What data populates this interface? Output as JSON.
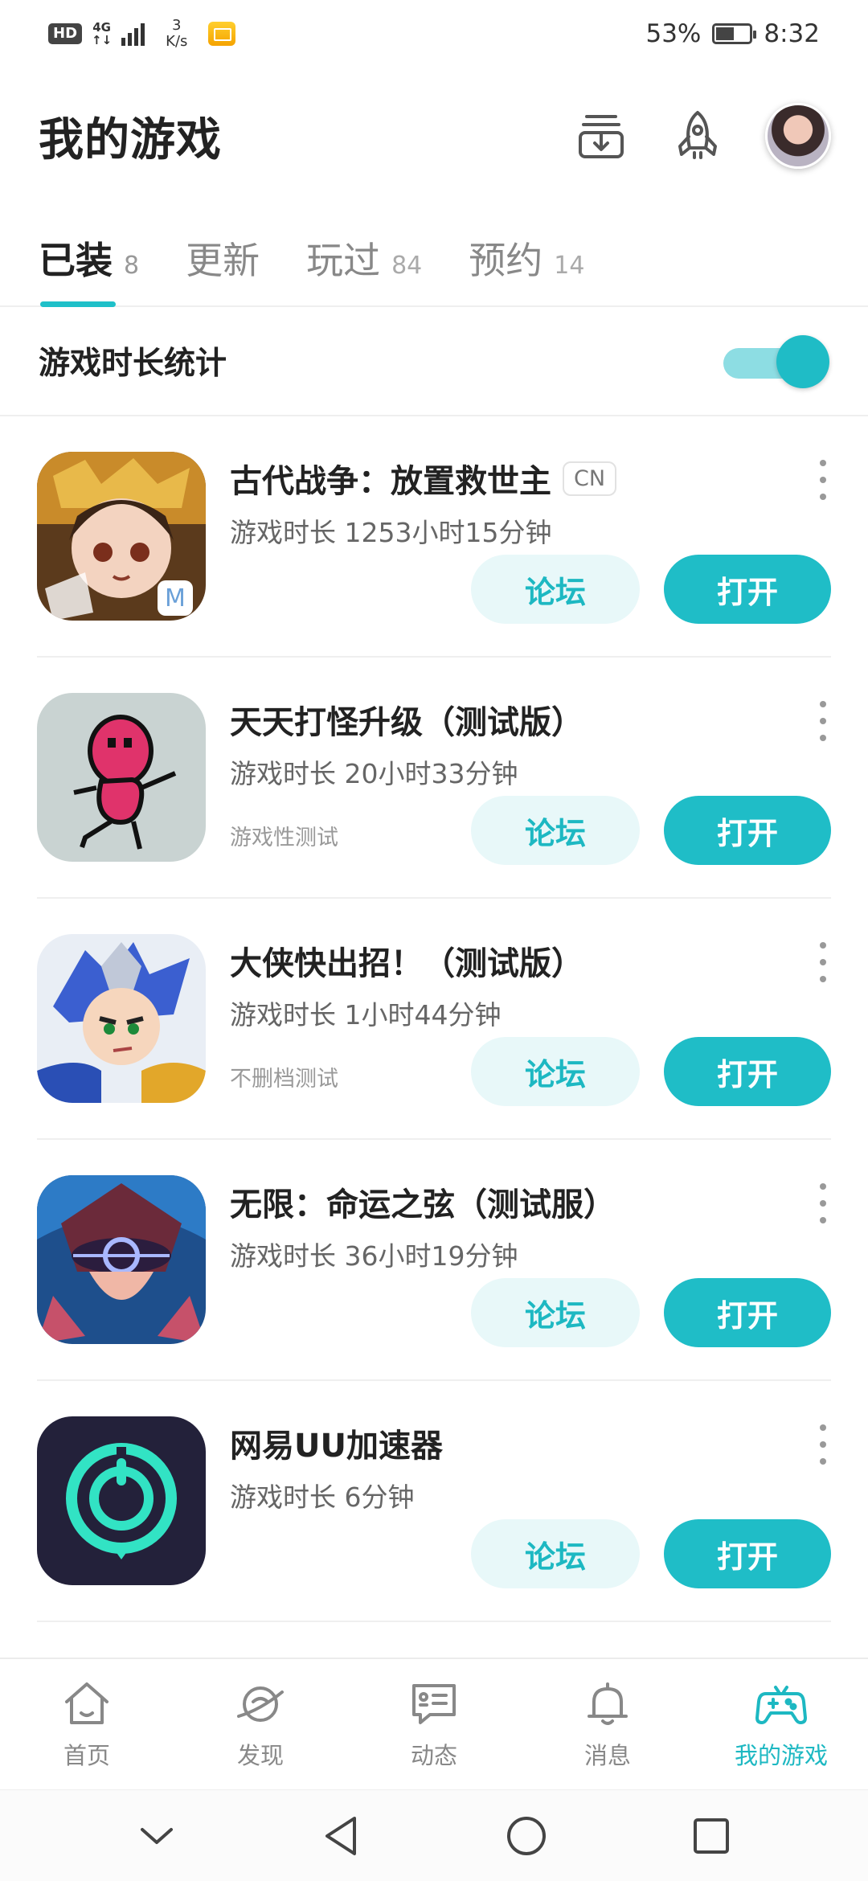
{
  "status_bar": {
    "hd": "HD",
    "net_type_top": "4G",
    "net_type_bottom": "↑↓",
    "speed_value": "3",
    "speed_unit": "K/s",
    "battery_percent": "53%",
    "battery_level": 0.53,
    "time": "8:32"
  },
  "header": {
    "title": "我的游戏",
    "icons": [
      "download-manager-icon",
      "rocket-icon",
      "avatar"
    ]
  },
  "tabs": [
    {
      "label": "已装",
      "count": "8",
      "active": true
    },
    {
      "label": "更新",
      "count": "",
      "active": false
    },
    {
      "label": "玩过",
      "count": "84",
      "active": false
    },
    {
      "label": "预约",
      "count": "14",
      "active": false
    }
  ],
  "stats": {
    "label": "游戏时长统计",
    "enabled": true
  },
  "games": [
    {
      "name": "古代战争：放置救世主",
      "tag": "CN",
      "playtime": "游戏时长 1253小时15分钟",
      "subtag": "",
      "forum_label": "论坛",
      "open_label": "打开"
    },
    {
      "name": "天天打怪升级（测试版）",
      "tag": "",
      "playtime": "游戏时长 20小时33分钟",
      "subtag": "游戏性测试",
      "forum_label": "论坛",
      "open_label": "打开"
    },
    {
      "name": "大侠快出招！（测试版）",
      "tag": "",
      "playtime": "游戏时长 1小时44分钟",
      "subtag": "不删档测试",
      "forum_label": "论坛",
      "open_label": "打开"
    },
    {
      "name": "无限：命运之弦（测试服）",
      "tag": "",
      "playtime": "游戏时长 36小时19分钟",
      "subtag": "",
      "forum_label": "论坛",
      "open_label": "打开"
    },
    {
      "name": "网易UU加速器",
      "tag": "",
      "playtime": "游戏时长 6分钟",
      "subtag": "",
      "forum_label": "论坛",
      "open_label": "打开"
    }
  ],
  "bottom_nav": [
    {
      "label": "首页",
      "icon": "home-icon",
      "active": false
    },
    {
      "label": "发现",
      "icon": "planet-icon",
      "active": false
    },
    {
      "label": "动态",
      "icon": "feed-icon",
      "active": false
    },
    {
      "label": "消息",
      "icon": "bell-icon",
      "active": false
    },
    {
      "label": "我的游戏",
      "icon": "gamepad-icon",
      "active": true
    }
  ],
  "colors": {
    "accent": "#1fbdc7",
    "accent_light": "#e8f8f9",
    "text_primary": "#222222",
    "text_secondary": "#666666"
  }
}
